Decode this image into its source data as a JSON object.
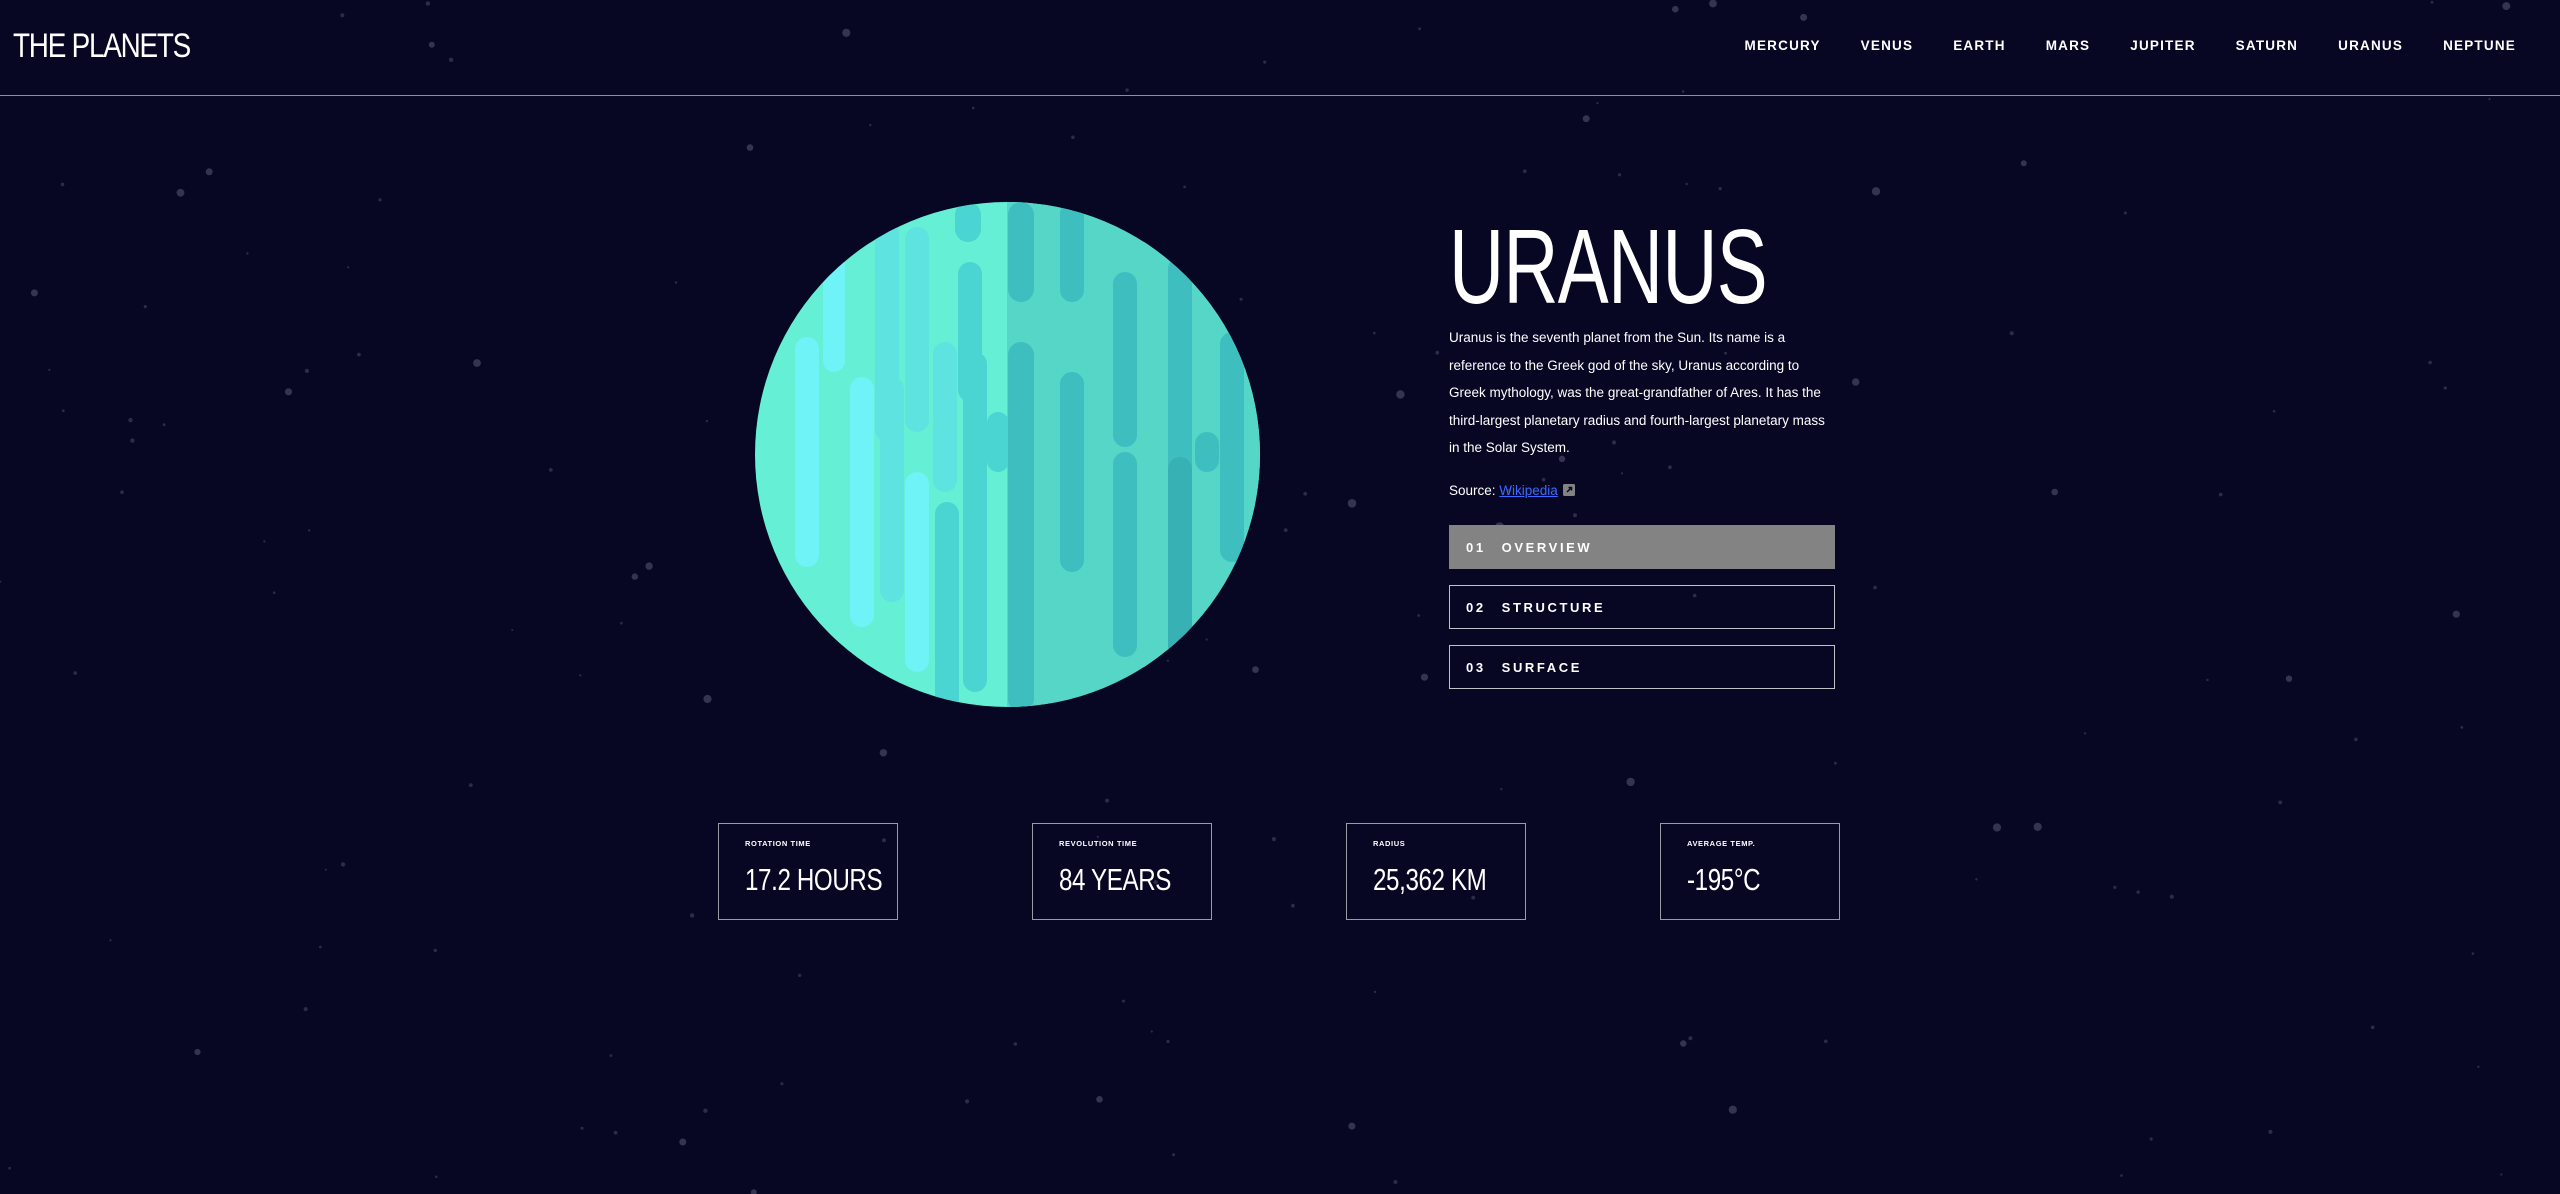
{
  "header": {
    "logo": "THE PLANETS",
    "nav": [
      "MERCURY",
      "VENUS",
      "EARTH",
      "MARS",
      "JUPITER",
      "SATURN",
      "URANUS",
      "NEPTUNE"
    ]
  },
  "planet": {
    "name": "URANUS",
    "description": "Uranus is the seventh planet from the Sun. Its name is a reference to the Greek god of the sky, Uranus according to Greek mythology, was the great-grandfather of Ares. It has the third-largest planetary radius and fourth-largest planetary mass in the Solar System.",
    "source_label": "Source:",
    "source_link": "Wikipedia",
    "source_icon": "external-link-icon"
  },
  "tabs": [
    {
      "num": "01",
      "label": "OVERVIEW",
      "active": true
    },
    {
      "num": "02",
      "label": "STRUCTURE",
      "active": false
    },
    {
      "num": "03",
      "label": "SURFACE",
      "active": false
    }
  ],
  "stats": [
    {
      "label": "ROTATION TIME",
      "value": "17.2 HOURS"
    },
    {
      "label": "REVOLUTION TIME",
      "value": "84 YEARS"
    },
    {
      "label": "RADIUS",
      "value": "25,362 KM"
    },
    {
      "label": "AVERAGE TEMP.",
      "value": "-195°C"
    }
  ],
  "colors": {
    "background": "#070724",
    "planet_base": "#65F0D5",
    "planet_light": "#6FF3F6",
    "planet_dark": "#3FBEC0",
    "active_tab": "#838383",
    "link": "#3B6CFF"
  }
}
